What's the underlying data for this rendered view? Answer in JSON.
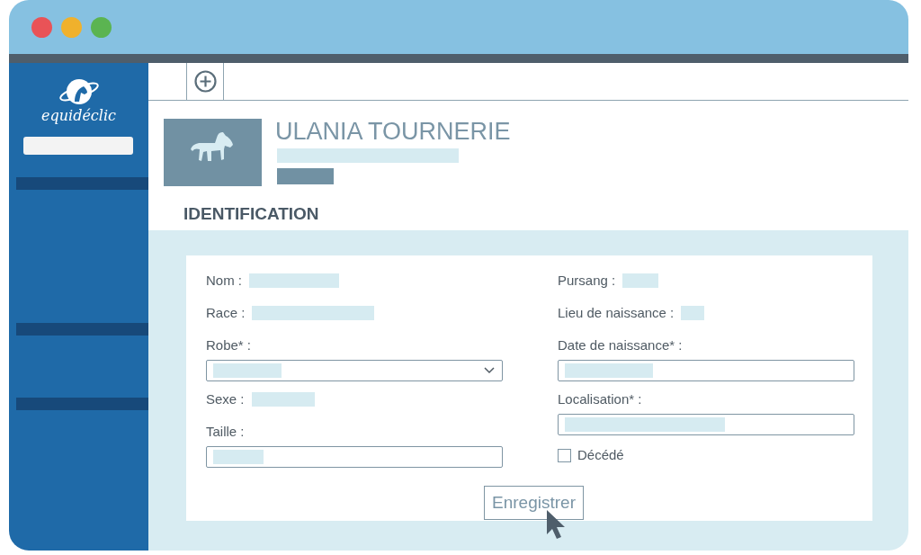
{
  "window": {
    "controls": [
      {
        "color": "#e95357"
      },
      {
        "color": "#f0b12c"
      },
      {
        "color": "#5bb451"
      }
    ]
  },
  "sidebar": {
    "logo_text": "equidéclic"
  },
  "profile": {
    "name": "ULANIA TOURNERIE"
  },
  "identification": {
    "title": "IDENTIFICATION",
    "left_fields": [
      {
        "kind": "value",
        "label": "Nom :"
      },
      {
        "kind": "value",
        "label": "Race :"
      },
      {
        "kind": "select",
        "label": "Robe* :"
      },
      {
        "kind": "value",
        "label": "Sexe :"
      },
      {
        "kind": "input",
        "label": "Taille :"
      }
    ],
    "right_fields": [
      {
        "kind": "value",
        "label": "Pursang :"
      },
      {
        "kind": "value",
        "label": "Lieu de naissance :"
      },
      {
        "kind": "input",
        "label": "Date de naissance* :"
      },
      {
        "kind": "input",
        "label": "Localisation* :"
      },
      {
        "kind": "checkbox",
        "label": "Décédé",
        "checked": false
      }
    ],
    "save_button": "Enregistrer"
  }
}
